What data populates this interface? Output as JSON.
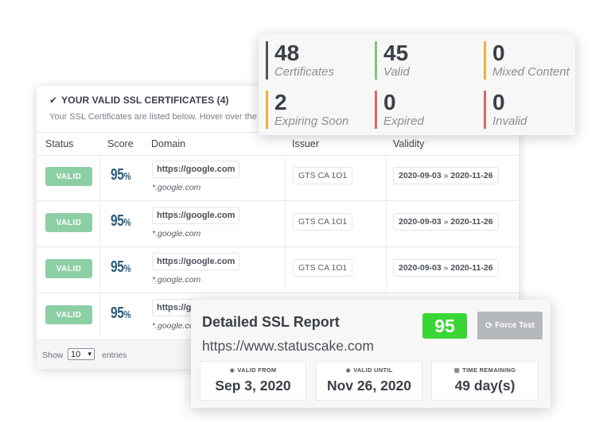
{
  "certificates_card": {
    "title": "YOUR VALID SSL CERTIFICATES (4)",
    "subtitle": "Your SSL Certificates are listed below. Hover over the",
    "columns": [
      "Status",
      "Score",
      "Domain",
      "Issuer",
      "Validity"
    ],
    "rows": [
      {
        "status": "VALID",
        "score": "95",
        "score_unit": "%",
        "domain": "https://google.com",
        "wildcard": "*.google.com",
        "issuer": "GTS CA 1O1",
        "valid_from": "2020-09-03",
        "valid_sep": "»",
        "valid_to": "2020-11-26"
      },
      {
        "status": "VALID",
        "score": "95",
        "score_unit": "%",
        "domain": "https://google.com",
        "wildcard": "*.google.com",
        "issuer": "GTS CA 1O1",
        "valid_from": "2020-09-03",
        "valid_sep": "»",
        "valid_to": "2020-11-26"
      },
      {
        "status": "VALID",
        "score": "95",
        "score_unit": "%",
        "domain": "https://google.com",
        "wildcard": "*.google.com",
        "issuer": "GTS CA 1O1",
        "valid_from": "2020-09-03",
        "valid_sep": "»",
        "valid_to": "2020-11-26"
      },
      {
        "status": "VALID",
        "score": "95",
        "score_unit": "%",
        "domain": "https://g",
        "wildcard": "*.google.co",
        "issuer": "",
        "valid_from": "",
        "valid_sep": "",
        "valid_to": ""
      }
    ],
    "footer": {
      "show": "Show",
      "page_size": "10",
      "entries": "entries"
    }
  },
  "stats": [
    {
      "value": "48",
      "label": "Certificates",
      "color": "#555555"
    },
    {
      "value": "45",
      "label": "Valid",
      "color": "#7cc576"
    },
    {
      "value": "0",
      "label": "Mixed Content",
      "color": "#e8b13b"
    },
    {
      "value": "2",
      "label": "Expiring Soon",
      "color": "#e8b13b"
    },
    {
      "value": "0",
      "label": "Expired",
      "color": "#e0636a"
    },
    {
      "value": "0",
      "label": "Invalid",
      "color": "#e0636a"
    }
  ],
  "report": {
    "title": "Detailed SSL Report",
    "url": "https://www.statuscake.com",
    "score": "95",
    "score_color": "#3ad635",
    "force_test": "Force Test",
    "valid_from_label": "VALID FROM",
    "valid_from": "Sep 3, 2020",
    "valid_until_label": "VALID UNTIL",
    "valid_until": "Nov 26, 2020",
    "time_remaining_label": "TIME REMAINING",
    "time_remaining": "49 day(s)"
  }
}
